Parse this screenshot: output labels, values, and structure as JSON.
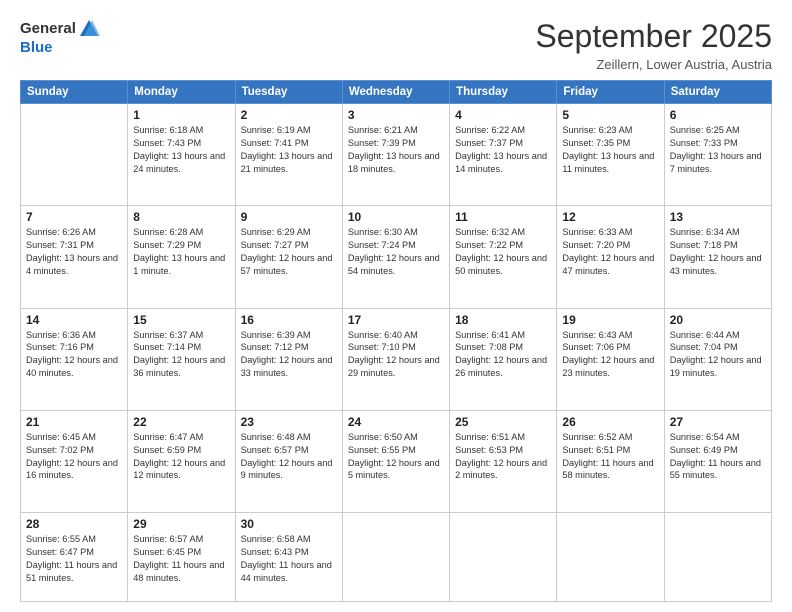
{
  "header": {
    "logo_general": "General",
    "logo_blue": "Blue",
    "month_title": "September 2025",
    "subtitle": "Zeillern, Lower Austria, Austria"
  },
  "weekdays": [
    "Sunday",
    "Monday",
    "Tuesday",
    "Wednesday",
    "Thursday",
    "Friday",
    "Saturday"
  ],
  "weeks": [
    [
      {
        "day": "",
        "sunrise": "",
        "sunset": "",
        "daylight": ""
      },
      {
        "day": "1",
        "sunrise": "Sunrise: 6:18 AM",
        "sunset": "Sunset: 7:43 PM",
        "daylight": "Daylight: 13 hours and 24 minutes."
      },
      {
        "day": "2",
        "sunrise": "Sunrise: 6:19 AM",
        "sunset": "Sunset: 7:41 PM",
        "daylight": "Daylight: 13 hours and 21 minutes."
      },
      {
        "day": "3",
        "sunrise": "Sunrise: 6:21 AM",
        "sunset": "Sunset: 7:39 PM",
        "daylight": "Daylight: 13 hours and 18 minutes."
      },
      {
        "day": "4",
        "sunrise": "Sunrise: 6:22 AM",
        "sunset": "Sunset: 7:37 PM",
        "daylight": "Daylight: 13 hours and 14 minutes."
      },
      {
        "day": "5",
        "sunrise": "Sunrise: 6:23 AM",
        "sunset": "Sunset: 7:35 PM",
        "daylight": "Daylight: 13 hours and 11 minutes."
      },
      {
        "day": "6",
        "sunrise": "Sunrise: 6:25 AM",
        "sunset": "Sunset: 7:33 PM",
        "daylight": "Daylight: 13 hours and 7 minutes."
      }
    ],
    [
      {
        "day": "7",
        "sunrise": "Sunrise: 6:26 AM",
        "sunset": "Sunset: 7:31 PM",
        "daylight": "Daylight: 13 hours and 4 minutes."
      },
      {
        "day": "8",
        "sunrise": "Sunrise: 6:28 AM",
        "sunset": "Sunset: 7:29 PM",
        "daylight": "Daylight: 13 hours and 1 minute."
      },
      {
        "day": "9",
        "sunrise": "Sunrise: 6:29 AM",
        "sunset": "Sunset: 7:27 PM",
        "daylight": "Daylight: 12 hours and 57 minutes."
      },
      {
        "day": "10",
        "sunrise": "Sunrise: 6:30 AM",
        "sunset": "Sunset: 7:24 PM",
        "daylight": "Daylight: 12 hours and 54 minutes."
      },
      {
        "day": "11",
        "sunrise": "Sunrise: 6:32 AM",
        "sunset": "Sunset: 7:22 PM",
        "daylight": "Daylight: 12 hours and 50 minutes."
      },
      {
        "day": "12",
        "sunrise": "Sunrise: 6:33 AM",
        "sunset": "Sunset: 7:20 PM",
        "daylight": "Daylight: 12 hours and 47 minutes."
      },
      {
        "day": "13",
        "sunrise": "Sunrise: 6:34 AM",
        "sunset": "Sunset: 7:18 PM",
        "daylight": "Daylight: 12 hours and 43 minutes."
      }
    ],
    [
      {
        "day": "14",
        "sunrise": "Sunrise: 6:36 AM",
        "sunset": "Sunset: 7:16 PM",
        "daylight": "Daylight: 12 hours and 40 minutes."
      },
      {
        "day": "15",
        "sunrise": "Sunrise: 6:37 AM",
        "sunset": "Sunset: 7:14 PM",
        "daylight": "Daylight: 12 hours and 36 minutes."
      },
      {
        "day": "16",
        "sunrise": "Sunrise: 6:39 AM",
        "sunset": "Sunset: 7:12 PM",
        "daylight": "Daylight: 12 hours and 33 minutes."
      },
      {
        "day": "17",
        "sunrise": "Sunrise: 6:40 AM",
        "sunset": "Sunset: 7:10 PM",
        "daylight": "Daylight: 12 hours and 29 minutes."
      },
      {
        "day": "18",
        "sunrise": "Sunrise: 6:41 AM",
        "sunset": "Sunset: 7:08 PM",
        "daylight": "Daylight: 12 hours and 26 minutes."
      },
      {
        "day": "19",
        "sunrise": "Sunrise: 6:43 AM",
        "sunset": "Sunset: 7:06 PM",
        "daylight": "Daylight: 12 hours and 23 minutes."
      },
      {
        "day": "20",
        "sunrise": "Sunrise: 6:44 AM",
        "sunset": "Sunset: 7:04 PM",
        "daylight": "Daylight: 12 hours and 19 minutes."
      }
    ],
    [
      {
        "day": "21",
        "sunrise": "Sunrise: 6:45 AM",
        "sunset": "Sunset: 7:02 PM",
        "daylight": "Daylight: 12 hours and 16 minutes."
      },
      {
        "day": "22",
        "sunrise": "Sunrise: 6:47 AM",
        "sunset": "Sunset: 6:59 PM",
        "daylight": "Daylight: 12 hours and 12 minutes."
      },
      {
        "day": "23",
        "sunrise": "Sunrise: 6:48 AM",
        "sunset": "Sunset: 6:57 PM",
        "daylight": "Daylight: 12 hours and 9 minutes."
      },
      {
        "day": "24",
        "sunrise": "Sunrise: 6:50 AM",
        "sunset": "Sunset: 6:55 PM",
        "daylight": "Daylight: 12 hours and 5 minutes."
      },
      {
        "day": "25",
        "sunrise": "Sunrise: 6:51 AM",
        "sunset": "Sunset: 6:53 PM",
        "daylight": "Daylight: 12 hours and 2 minutes."
      },
      {
        "day": "26",
        "sunrise": "Sunrise: 6:52 AM",
        "sunset": "Sunset: 6:51 PM",
        "daylight": "Daylight: 11 hours and 58 minutes."
      },
      {
        "day": "27",
        "sunrise": "Sunrise: 6:54 AM",
        "sunset": "Sunset: 6:49 PM",
        "daylight": "Daylight: 11 hours and 55 minutes."
      }
    ],
    [
      {
        "day": "28",
        "sunrise": "Sunrise: 6:55 AM",
        "sunset": "Sunset: 6:47 PM",
        "daylight": "Daylight: 11 hours and 51 minutes."
      },
      {
        "day": "29",
        "sunrise": "Sunrise: 6:57 AM",
        "sunset": "Sunset: 6:45 PM",
        "daylight": "Daylight: 11 hours and 48 minutes."
      },
      {
        "day": "30",
        "sunrise": "Sunrise: 6:58 AM",
        "sunset": "Sunset: 6:43 PM",
        "daylight": "Daylight: 11 hours and 44 minutes."
      },
      {
        "day": "",
        "sunrise": "",
        "sunset": "",
        "daylight": ""
      },
      {
        "day": "",
        "sunrise": "",
        "sunset": "",
        "daylight": ""
      },
      {
        "day": "",
        "sunrise": "",
        "sunset": "",
        "daylight": ""
      },
      {
        "day": "",
        "sunrise": "",
        "sunset": "",
        "daylight": ""
      }
    ]
  ]
}
